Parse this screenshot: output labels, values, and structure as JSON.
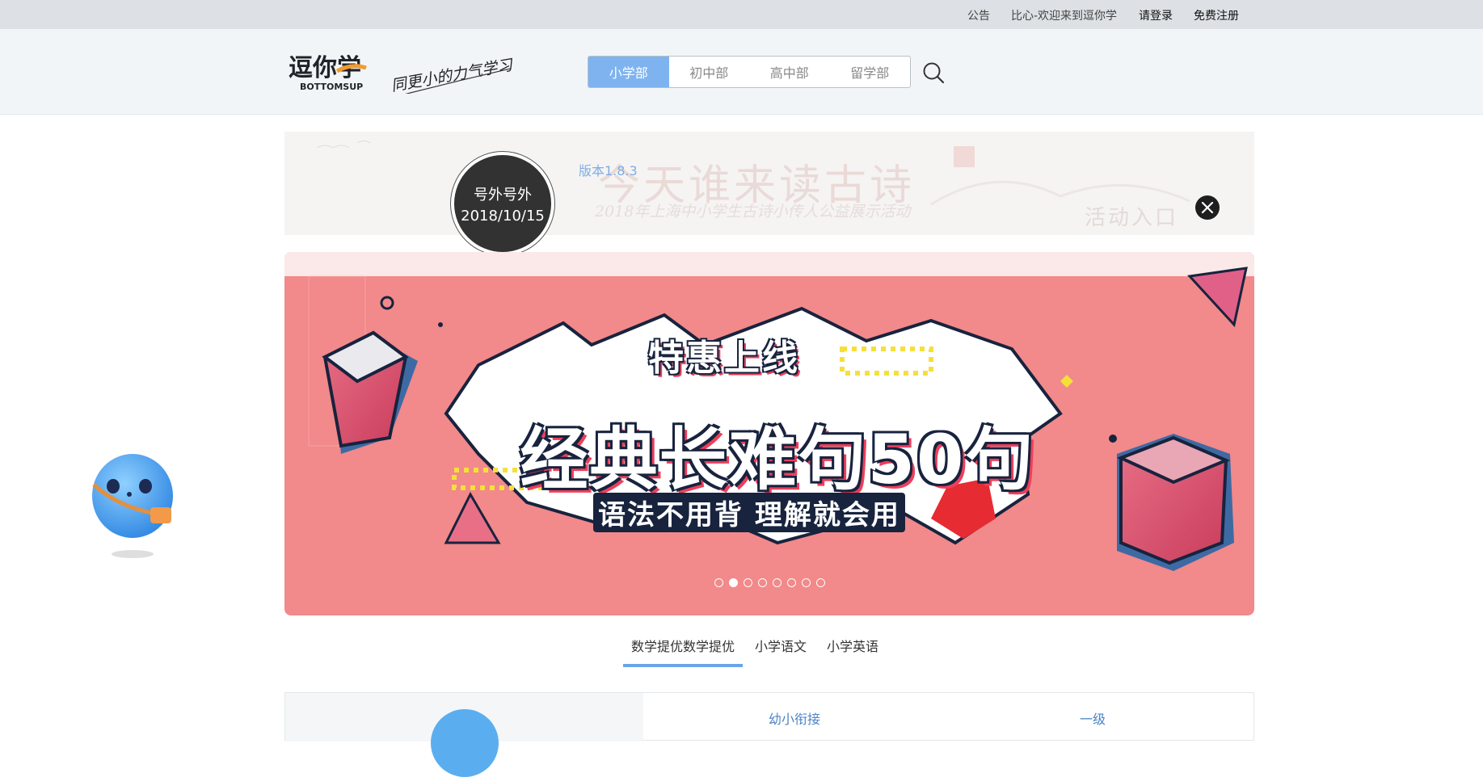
{
  "topbar": {
    "announcement": "公告",
    "welcome": "比心-欢迎来到逗你学",
    "login": "请登录",
    "register": "免费注册"
  },
  "logo": {
    "name": "逗你学",
    "en": "BOTTOMSUP",
    "slogan": "同更小的力气学习"
  },
  "nav": {
    "tabs": [
      "小学部",
      "初中部",
      "高中部",
      "留学部"
    ],
    "active_index": 0
  },
  "notice": {
    "poem_title": "今天谁来读古诗",
    "poem_subtitle": "2018年上海中小学生古诗小传人公益展示活动",
    "poem_entry": "活动入口",
    "version": "版本1.8.3",
    "badge_line1": "号外号外",
    "badge_line2": "2018/10/15"
  },
  "banner": {
    "top_line": "特惠上线",
    "headline": "经典长难句50句",
    "sub_line": "语法不用背 理解就会用",
    "slides": 8,
    "active_slide": 1,
    "colors": {
      "background": "#f2898a",
      "outline": "#18233e",
      "accent": "#ee3f5b"
    }
  },
  "subject_tabs": {
    "items": [
      "数学提优数学提优",
      "小学语文",
      "小学英语"
    ],
    "active_index": 0
  },
  "panel": {
    "levels": [
      "幼小衔接",
      "一级"
    ]
  },
  "icons": {
    "search": "search-icon",
    "close": "close-icon"
  }
}
